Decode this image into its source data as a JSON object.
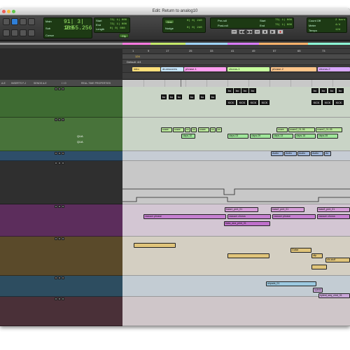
{
  "window": {
    "title": "Edit: Return to analog10"
  },
  "counters": {
    "main_label": "Main",
    "main_value": "91| 3| 189",
    "sub_label": "Sub",
    "sub_value": "2:55.256",
    "cursor_label": "Cursor",
    "start_label": "Start",
    "end_label": "End",
    "length_label": "Length",
    "start_value": "73| 1| 000",
    "end_value": "73| 1| 000",
    "length_value": "0| 0| 000"
  },
  "grid": {
    "grid_label": "Grid",
    "nudge_label": "Nudge",
    "grid_value": "0| 0| 240",
    "nudge_value": "0| 0| 240",
    "cue_label": "Cty"
  },
  "transport": {
    "preroll": "Pre-roll",
    "postroll": "Post-roll",
    "t_start": "Start",
    "t_end": "End",
    "t_length": "Length",
    "pre_value": "0| 0| 000",
    "post_value": "0| 0| 000",
    "tstart_value": "73| 1| 000",
    "tend_value": "73| 1| 000",
    "tlength_value": "0| 0| 000"
  },
  "meter": {
    "count_label": "Count Off",
    "meter_label": "Meter",
    "tempo_label": "Tempo",
    "count_value": "2 bars",
    "meter_value": "4/4",
    "tempo_value": "124"
  },
  "mixer_headers": [
    "A-E",
    "INSERTS F-J",
    "SENDS A-E",
    "I / O",
    "REAL-TIME PROPERTIES"
  ],
  "ruler": {
    "bar_numbers": [
      "1",
      "9",
      "17",
      "25",
      "33",
      "41",
      "49",
      "57",
      "65",
      "73"
    ],
    "tempo_value": "124",
    "meter_value": "Default: 4/4",
    "markers": [
      "intro",
      "drumscores",
      "phrase-1",
      "chorus-1",
      "phrase-2",
      "chorus-2"
    ]
  },
  "track_tags": [
    "QUA",
    "QUA"
  ],
  "clip_labels": {
    "kick_top": [
      "bo",
      "bo",
      "bo",
      "bo",
      "bo",
      "bo",
      "bo",
      "bo",
      "bo",
      "bo",
      "bo",
      "bo",
      "bo",
      "bo"
    ],
    "kick": [
      "KICK",
      "KICK",
      "KICK",
      "KICK",
      "KICK",
      "KICK",
      "KICK"
    ],
    "snare_row": [
      "snare",
      "snare",
      "sn",
      "sn",
      "snare",
      "sn",
      "sn",
      "snare",
      "snare2_01-96",
      "snare2_01-05"
    ],
    "claps": [
      "claps-10",
      "claps-03",
      "claps-09",
      "claps-13",
      "claps-16",
      "claps-05"
    ],
    "audio": [
      "Audio",
      "Audio",
      "Audio",
      "Audio",
      "Au"
    ],
    "bass_row": [
      "bass1_prnt_01",
      "bass2_prnt_01",
      "bass3_prnt_01"
    ],
    "vacuum": [
      "vacuum phrase",
      "vacuum chorus",
      "vacuum phrase",
      "vacuum chorus"
    ],
    "bass_print": "bass_ana_print_01",
    "guitar": [
      "Guitar",
      "slip",
      "sfx-stuff"
    ],
    "pad": "airpads_01",
    "hybrid": [
      "hybrid",
      "hybrid_seq_chrd_01"
    ]
  },
  "status": {
    "play_label": "play"
  }
}
